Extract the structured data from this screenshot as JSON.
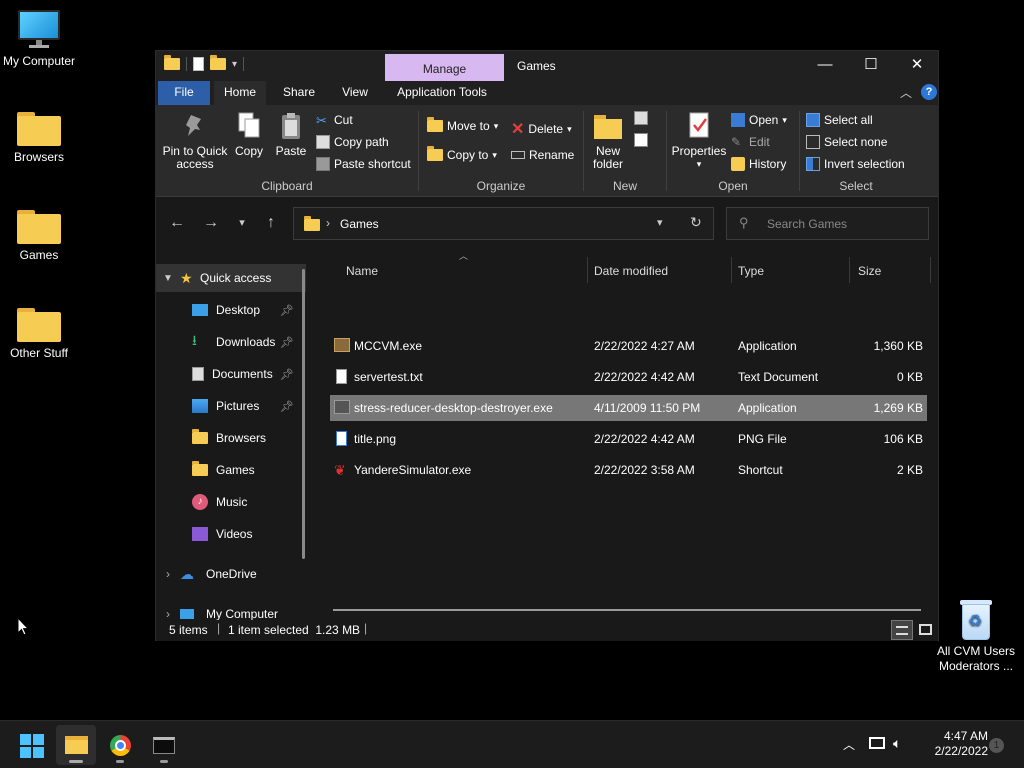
{
  "desktop": {
    "icons": [
      {
        "label": "My Computer",
        "icon": "monitor-icon"
      },
      {
        "label": "Browsers",
        "icon": "folder-icon"
      },
      {
        "label": "Games",
        "icon": "folder-icon"
      },
      {
        "label": "Other Stuff",
        "icon": "folder-icon"
      }
    ],
    "recycle_bin_label": "All CVM Users Moderators ...",
    "recycle_line1": "All CVM Users",
    "recycle_line2": "Moderators ..."
  },
  "window": {
    "manage_tab": "Manage",
    "title": "Games",
    "controls": {
      "minimize": "—",
      "maximize": "☐",
      "close": "✕"
    }
  },
  "ribbon_tabs": {
    "file": "File",
    "home": "Home",
    "share": "Share",
    "view": "View",
    "app_tools": "Application Tools"
  },
  "ribbon": {
    "clipboard": {
      "group": "Clipboard",
      "pin_line1": "Pin to Quick",
      "pin_line2": "access",
      "copy": "Copy",
      "paste": "Paste",
      "cut": "Cut",
      "copy_path": "Copy path",
      "paste_shortcut": "Paste shortcut"
    },
    "organize": {
      "group": "Organize",
      "move_to": "Move to",
      "copy_to": "Copy to",
      "delete": "Delete",
      "rename": "Rename"
    },
    "new": {
      "group": "New",
      "new_folder_line1": "New",
      "new_folder_line2": "folder"
    },
    "open": {
      "group": "Open",
      "properties": "Properties",
      "open": "Open",
      "edit": "Edit",
      "history": "History"
    },
    "select": {
      "group": "Select",
      "select_all": "Select all",
      "select_none": "Select none",
      "invert": "Invert selection"
    }
  },
  "address": {
    "path": "Games",
    "search_placeholder": "Search Games"
  },
  "nav": {
    "quick_access": "Quick access",
    "items": [
      {
        "label": "Desktop",
        "pinned": true
      },
      {
        "label": "Downloads",
        "pinned": true
      },
      {
        "label": "Documents",
        "pinned": true
      },
      {
        "label": "Pictures",
        "pinned": true
      },
      {
        "label": "Browsers",
        "pinned": false
      },
      {
        "label": "Games",
        "pinned": false
      },
      {
        "label": "Music",
        "pinned": false
      },
      {
        "label": "Videos",
        "pinned": false
      }
    ],
    "onedrive": "OneDrive",
    "my_computer": "My Computer"
  },
  "columns": {
    "name": "Name",
    "date": "Date modified",
    "type": "Type",
    "size": "Size"
  },
  "files": [
    {
      "name": "MCCVM.exe",
      "date": "2/22/2022 4:27 AM",
      "type": "Application",
      "size": "1,360 KB",
      "icon": "app-icon",
      "selected": false
    },
    {
      "name": "servertest.txt",
      "date": "2/22/2022 4:42 AM",
      "type": "Text Document",
      "size": "0 KB",
      "icon": "text-file-icon",
      "selected": false
    },
    {
      "name": "stress-reducer-desktop-destroyer.exe",
      "date": "4/11/2009 11:50 PM",
      "type": "Application",
      "size": "1,269 KB",
      "icon": "app-icon",
      "selected": true
    },
    {
      "name": "title.png",
      "date": "2/22/2022 4:42 AM",
      "type": "PNG File",
      "size": "106 KB",
      "icon": "image-file-icon",
      "selected": false
    },
    {
      "name": "YandereSimulator.exe",
      "date": "2/22/2022 3:58 AM",
      "type": "Shortcut",
      "size": "2 KB",
      "icon": "shortcut-icon",
      "selected": false
    }
  ],
  "status": {
    "count": "5 items",
    "selected": "1 item selected  1.23 MB"
  },
  "taskbar": {
    "time": "4:47 AM",
    "date": "2/22/2022",
    "notification_count": "1"
  },
  "colors": {
    "manage_tab": "#d8b8f0",
    "file_tab": "#2d5ea8",
    "folder": "#f7cc52",
    "selection": "#777777"
  }
}
